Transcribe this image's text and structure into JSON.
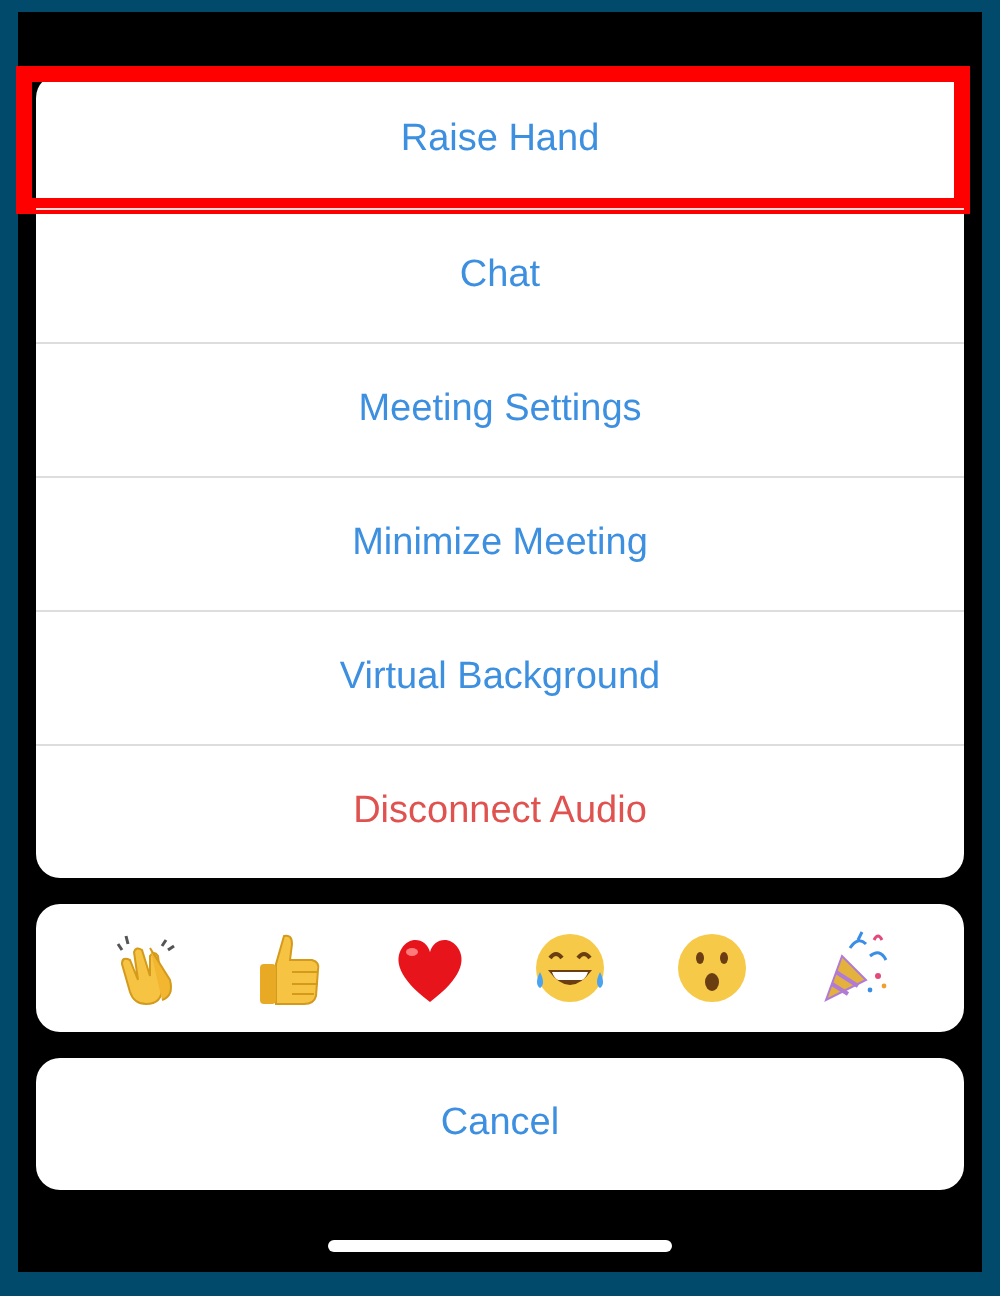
{
  "action_sheet": {
    "items": [
      {
        "label": "Raise Hand",
        "kind": "default",
        "highlighted": true
      },
      {
        "label": "Chat",
        "kind": "default",
        "highlighted": false
      },
      {
        "label": "Meeting Settings",
        "kind": "default",
        "highlighted": false
      },
      {
        "label": "Minimize Meeting",
        "kind": "default",
        "highlighted": false
      },
      {
        "label": "Virtual Background",
        "kind": "default",
        "highlighted": false
      },
      {
        "label": "Disconnect Audio",
        "kind": "destructive",
        "highlighted": false
      }
    ]
  },
  "reactions": [
    {
      "kind": "clap"
    },
    {
      "kind": "thumbs-up"
    },
    {
      "kind": "heart"
    },
    {
      "kind": "laugh"
    },
    {
      "kind": "surprised"
    },
    {
      "kind": "party"
    }
  ],
  "cancel_button": {
    "label": "Cancel"
  }
}
